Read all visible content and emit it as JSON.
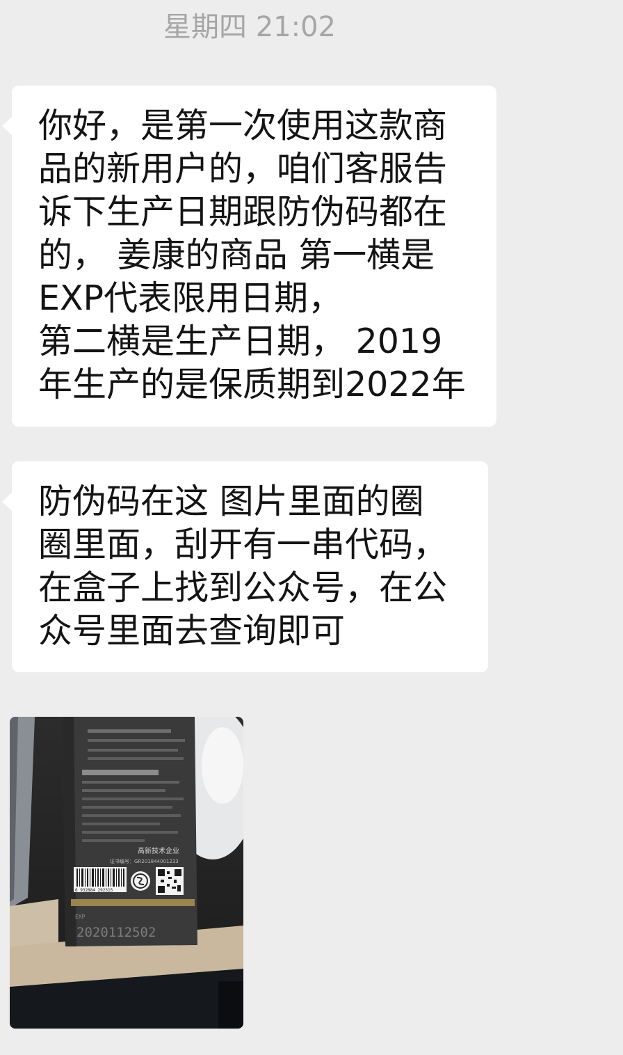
{
  "chat": {
    "timestamp": "星期四 21:02",
    "messages": [
      {
        "text": "你好，是第一次使用这款商\n品的新用户的，咱们客服告\n诉下生产日期跟防伪码都在\n的， 姜康的商品  第一横是\nEXP代表限用日期，\n第二横是生产日期，   2019\n年生产的是保质期到2022年"
      },
      {
        "text": "防伪码在这    图片里面的圈\n圈里面，刮开有一串代码，\n在盒子上找到公众号，在公\n众号里面去查询即可"
      }
    ],
    "image": {
      "box_label": "高新技术企业",
      "cert_number": "证书编号：GR201844001233",
      "barcode_number": "6 932884 292315",
      "date_stamp": "2020112502"
    }
  },
  "colors": {
    "background": "#ededed",
    "bubble": "#ffffff",
    "text": "#141414",
    "timestamp": "#a6a6a6"
  }
}
